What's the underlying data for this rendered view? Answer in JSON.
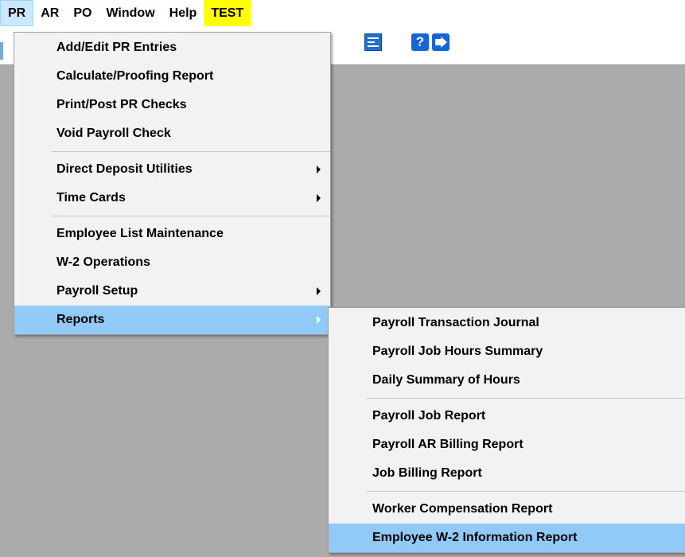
{
  "menubar": {
    "items": [
      "PR",
      "AR",
      "PO",
      "Window",
      "Help",
      "TEST"
    ],
    "active": "PR"
  },
  "toolbar": {
    "icons": [
      "list-icon",
      "help-icon",
      "exit-icon"
    ],
    "help_glyph": "?"
  },
  "pr_menu": {
    "group1": [
      "Add/Edit PR Entries",
      "Calculate/Proofing Report",
      "Print/Post PR Checks",
      "Void Payroll Check"
    ],
    "group2": [
      "Direct Deposit Utilities",
      "Time Cards"
    ],
    "group3": [
      "Employee List Maintenance",
      "W-2 Operations",
      "Payroll Setup",
      "Reports"
    ],
    "highlighted": "Reports"
  },
  "reports_menu": {
    "group1": [
      "Payroll Transaction Journal",
      "Payroll Job Hours Summary",
      "Daily Summary of Hours"
    ],
    "group2": [
      "Payroll Job Report",
      "Payroll AR Billing Report",
      "Job Billing Report"
    ],
    "group3": [
      "Worker Compensation Report",
      "Employee W-2 Information Report"
    ],
    "highlighted": "Employee W-2 Information Report"
  },
  "colors": {
    "menu_highlight": "#91c9f7",
    "test_background": "#ffff00",
    "workspace": "#ababab"
  }
}
